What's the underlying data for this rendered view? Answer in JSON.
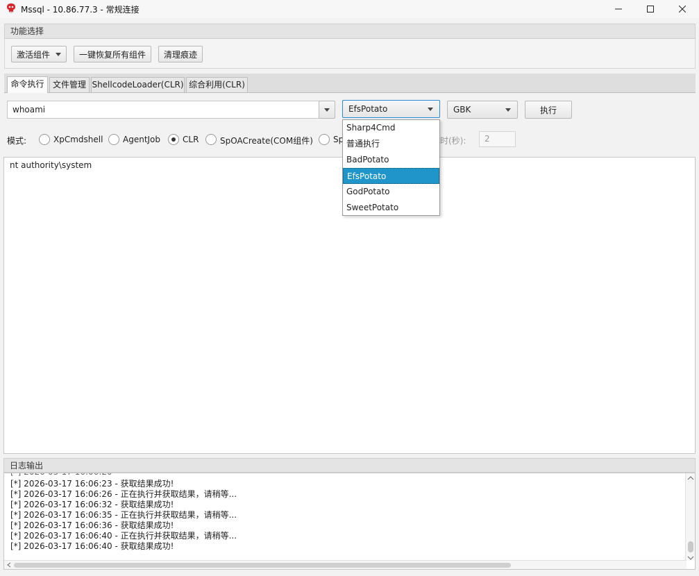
{
  "window": {
    "title": "Mssql - 10.86.77.3 - 常规连接"
  },
  "func_panel": {
    "header": "功能选择",
    "activate_label": "激活组件",
    "restore_label": "一键恢复所有组件",
    "clean_label": "清理痕迹"
  },
  "tabs": [
    {
      "label": "命令执行"
    },
    {
      "label": "文件管理"
    },
    {
      "label": "ShellcodeLoader(CLR)"
    },
    {
      "label": "综合利用(CLR)"
    }
  ],
  "command": {
    "value": "whoami",
    "potato_selected": "EfsPotato",
    "encoding_selected": "GBK",
    "execute_label": "执行"
  },
  "mode": {
    "label": "模式:",
    "options": [
      "XpCmdshell",
      "AgentJob",
      "CLR",
      "SpOACreate(COM组件)",
      "Sp"
    ],
    "selected": "CLR",
    "timeout_label": "时(秒):",
    "timeout_value": "2"
  },
  "dropdown": {
    "items": [
      "Sharp4Cmd",
      "普通执行",
      "BadPotato",
      "EfsPotato",
      "GodPotato",
      "SweetPotato"
    ],
    "selected": "EfsPotato"
  },
  "output": {
    "text": "nt authority\\system"
  },
  "log": {
    "header": "日志输出",
    "lines": [
      "[*] 2026-03-17 16:06:23 - 获取结果成功!",
      "[*] 2026-03-17 16:06:26 - 正在执行并获取结果，请稍等...",
      "[*] 2026-03-17 16:06:32 - 获取结果成功!",
      "[*] 2026-03-17 16:06:35 - 正在执行并获取结果，请稍等...",
      "[*] 2026-03-17 16:06:36 - 获取结果成功!",
      "[*] 2026-03-17 16:06:40 - 正在执行并获取结果，请稍等...",
      "[*] 2026-03-17 16:06:40 - 获取结果成功!"
    ]
  },
  "colors": {
    "accent": "#1f95c9",
    "icon": "#d8232a"
  }
}
